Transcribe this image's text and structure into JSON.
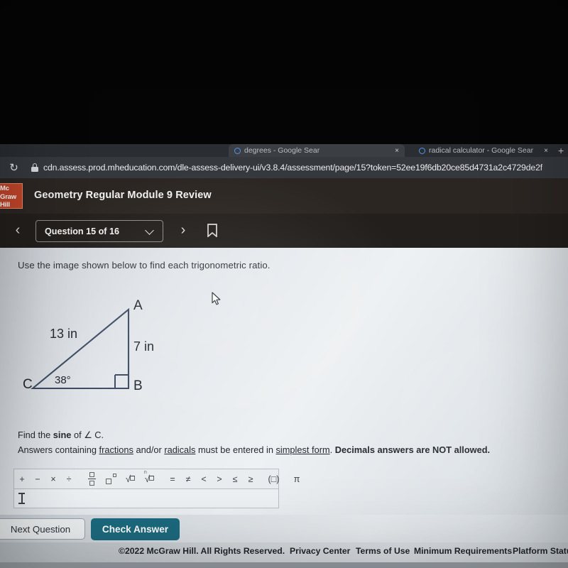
{
  "browser": {
    "reload_icon": "reload-icon",
    "lock_icon": "lock-icon",
    "url": "cdn.assess.prod.mheducation.com/dle-assess-delivery-ui/v3.8.4/assessment/page/15?token=52ee19f6db20ce85d4731a2c4729de2f",
    "new_tab_label": "+",
    "tabs": [
      {
        "title": "degrees - Google Sear",
        "close_label": "×"
      },
      {
        "title": "radical calculator - Google Sear",
        "close_label": "×"
      }
    ]
  },
  "app": {
    "logo_line1": "Mc",
    "logo_line2": "Graw",
    "logo_line3": "Hill",
    "title": "Geometry Regular Module 9 Review",
    "logo_color": "#c1452a"
  },
  "nav": {
    "back_label": "‹",
    "forward_label": "›",
    "question_label": "Question 15 of 16",
    "chevron_icon": "chevron-down-icon",
    "bookmark_icon": "bookmark-icon"
  },
  "question": {
    "prompt": "Use the image shown below to find each trigonometric ratio.",
    "find_prefix": "Find the ",
    "find_bold": "sine",
    "find_suffix": " of ∠ C.",
    "note_a": "Answers containing ",
    "note_fractions": "fractions",
    "note_b": " and/or ",
    "note_radicals": "radicals",
    "note_c": " must be entered in ",
    "note_simplest": "simplest form",
    "note_d": ".  ",
    "note_bold": "Decimals answers are NOT allowed."
  },
  "figure": {
    "vertex_a": "A",
    "vertex_b": "B",
    "vertex_c": "C",
    "hypotenuse_label": "13 in",
    "opposite_label": "7 in",
    "angle_label": "38°",
    "right_angle_icon": "right-angle-marker",
    "stroke_color": "#3c4a63"
  },
  "mathbar": {
    "buttons": [
      {
        "name": "plus-button",
        "label": "+"
      },
      {
        "name": "minus-button",
        "label": "−"
      },
      {
        "name": "multiply-button",
        "label": "×"
      },
      {
        "name": "divide-button",
        "label": "÷"
      },
      {
        "name": "equals-button",
        "label": "="
      },
      {
        "name": "not-equals-button",
        "label": "≠"
      },
      {
        "name": "less-than-button",
        "label": "<"
      },
      {
        "name": "greater-than-button",
        "label": ">"
      },
      {
        "name": "less-equal-button",
        "label": "≤"
      },
      {
        "name": "greater-equal-button",
        "label": "≥"
      },
      {
        "name": "parentheses-button",
        "label": "(□)"
      },
      {
        "name": "pi-button",
        "label": "π"
      }
    ],
    "fraction_icon": "fraction-icon",
    "exponent_icon": "exponent-icon",
    "sqrt_icon": "square-root-icon",
    "nthroot_icon": "nth-root-icon",
    "nth_index": "n"
  },
  "answer": {
    "value": "",
    "caret_icon": "text-caret"
  },
  "actions": {
    "next_label": "Next Question",
    "check_label": "Check Answer",
    "check_color": "#1d6a7f"
  },
  "footer": {
    "copyright": "©2022 McGraw Hill. All Rights Reserved.",
    "links": [
      "Privacy Center",
      "Terms of Use",
      "Minimum Requirements",
      "Platform Status"
    ]
  },
  "cursor": {
    "icon": "mouse-pointer"
  }
}
